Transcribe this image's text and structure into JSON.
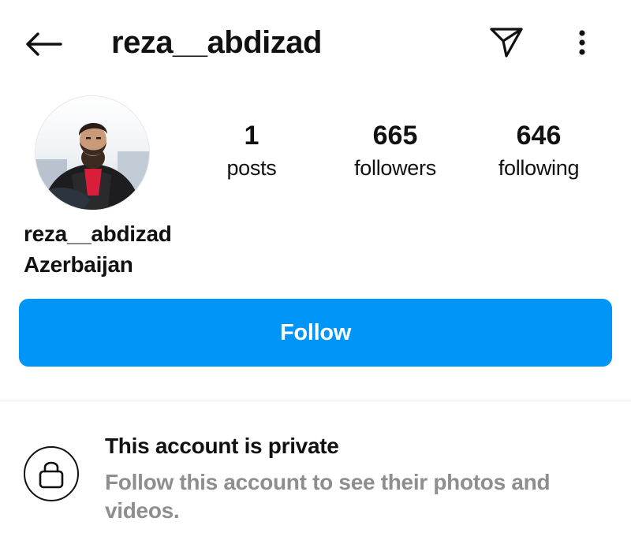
{
  "header": {
    "username": "reza__abdizad",
    "back_icon": "arrow-left-icon",
    "share_icon": "paper-plane-icon",
    "more_icon": "more-vertical-icon"
  },
  "profile": {
    "avatar_alt": "profile photo",
    "stats": {
      "posts": {
        "count": "1",
        "label": "posts"
      },
      "followers": {
        "count": "665",
        "label": "followers"
      },
      "following": {
        "count": "646",
        "label": "following"
      }
    },
    "name": "reza__abdizad",
    "location": "Azerbaijan"
  },
  "actions": {
    "follow_label": "Follow",
    "follow_color": "#0095f6"
  },
  "private_notice": {
    "icon": "lock-icon",
    "title": "This account is private",
    "description": "Follow this account to see their photos and videos."
  }
}
